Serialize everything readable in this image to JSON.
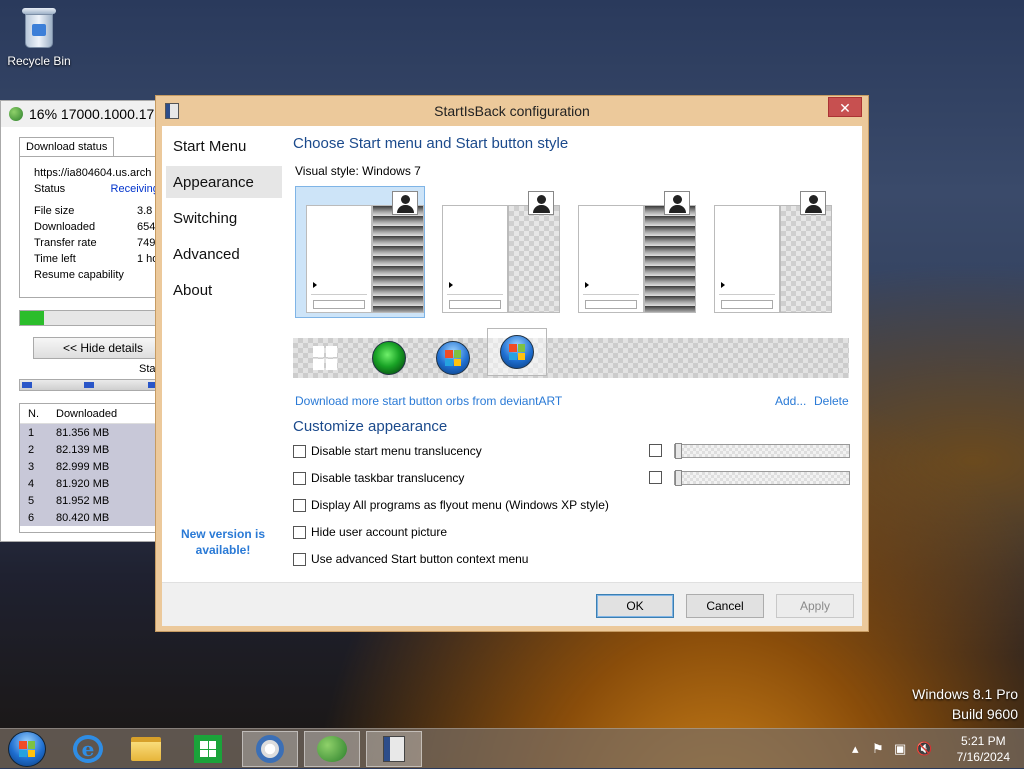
{
  "desktop": {
    "recycle_bin_label": "Recycle Bin",
    "watermark_line1": "Windows 8.1 Pro",
    "watermark_line2": "Build 9600"
  },
  "download_window": {
    "title": "16% 17000.1000.17",
    "tab_label": "Download status",
    "url": "https://ia804604.us.arch",
    "rows": [
      {
        "key": "Status",
        "value": "Receiving d"
      },
      {
        "key": "File size",
        "value": "3.8"
      },
      {
        "key": "Downloaded",
        "value": "654"
      },
      {
        "key": "Transfer rate",
        "value": "749"
      },
      {
        "key": "Time left",
        "value": "1 ho"
      },
      {
        "key": "Resume capability",
        "value": ""
      }
    ],
    "progress_percent": 16,
    "hide_details_label": "<< Hide details",
    "status_fragment": "Sta",
    "table_headers": [
      "N.",
      "Downloaded"
    ],
    "table_rows": [
      [
        "1",
        "81.356 MB"
      ],
      [
        "2",
        "82.139 MB"
      ],
      [
        "3",
        "82.999 MB"
      ],
      [
        "4",
        "81.920 MB"
      ],
      [
        "5",
        "81.952 MB"
      ],
      [
        "6",
        "80.420 MB"
      ]
    ]
  },
  "dialog": {
    "title": "StartIsBack configuration",
    "close_glyph": "✕",
    "nav": [
      {
        "label": "Start Menu",
        "selected": false
      },
      {
        "label": "Appearance",
        "selected": true
      },
      {
        "label": "Switching",
        "selected": false
      },
      {
        "label": "Advanced",
        "selected": false
      },
      {
        "label": "About",
        "selected": false
      }
    ],
    "update_notice": "New version is available!",
    "section1_title": "Choose Start menu and Start button style",
    "visual_style_label": "Visual style:",
    "visual_style_value": "Windows 7",
    "selected_style_index": 0,
    "selected_orb_index": 3,
    "deviantart_link": "Download more start button orbs from deviantART",
    "add_link": "Add...",
    "delete_link": "Delete",
    "section2_title": "Customize appearance",
    "options": [
      {
        "label": "Disable start menu translucency",
        "checked": false
      },
      {
        "label": "Disable taskbar translucency",
        "checked": false
      },
      {
        "label": "Display All programs as flyout menu (Windows XP style)",
        "checked": false
      },
      {
        "label": "Hide user account picture",
        "checked": false
      },
      {
        "label": "Use advanced Start button context menu",
        "checked": false
      }
    ],
    "buttons": {
      "ok": "OK",
      "cancel": "Cancel",
      "apply": "Apply"
    }
  },
  "taskbar": {
    "clock_time": "5:21 PM",
    "clock_date": "7/16/2024"
  },
  "colors": {
    "dialog_frame": "#ecc99b",
    "accent_blue": "#1b4a8c",
    "link_blue": "#2a7ad6",
    "close_red": "#c75050",
    "progress_green": "#2bbd2b"
  }
}
